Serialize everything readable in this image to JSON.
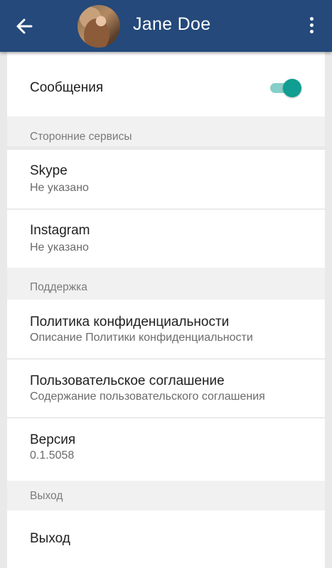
{
  "header": {
    "back_icon": "arrow-left-icon",
    "user_name": "Jane Doe",
    "more_icon": "more-vertical-icon"
  },
  "messages": {
    "label": "Сообщения",
    "toggle_on": true,
    "accent_color": "#0f9e91"
  },
  "third_party": {
    "section_label": "Сторонние сервисы",
    "items": [
      {
        "title": "Skype",
        "subtitle": "Не указано"
      },
      {
        "title": "Instagram",
        "subtitle": "Не указано"
      }
    ]
  },
  "support": {
    "section_label": "Поддержка",
    "items": [
      {
        "title": "Политика конфиденциальности",
        "subtitle": "Описание Политики конфиденциальности"
      },
      {
        "title": "Пользовательское соглашение",
        "subtitle": "Содержание пользовательского соглашения"
      },
      {
        "title": "Версия",
        "subtitle": "0.1.5058"
      }
    ]
  },
  "logout": {
    "section_label": "Выход",
    "item_label": "Выход"
  },
  "colors": {
    "app_bar": "#24497a",
    "background": "#e9e9e9"
  }
}
